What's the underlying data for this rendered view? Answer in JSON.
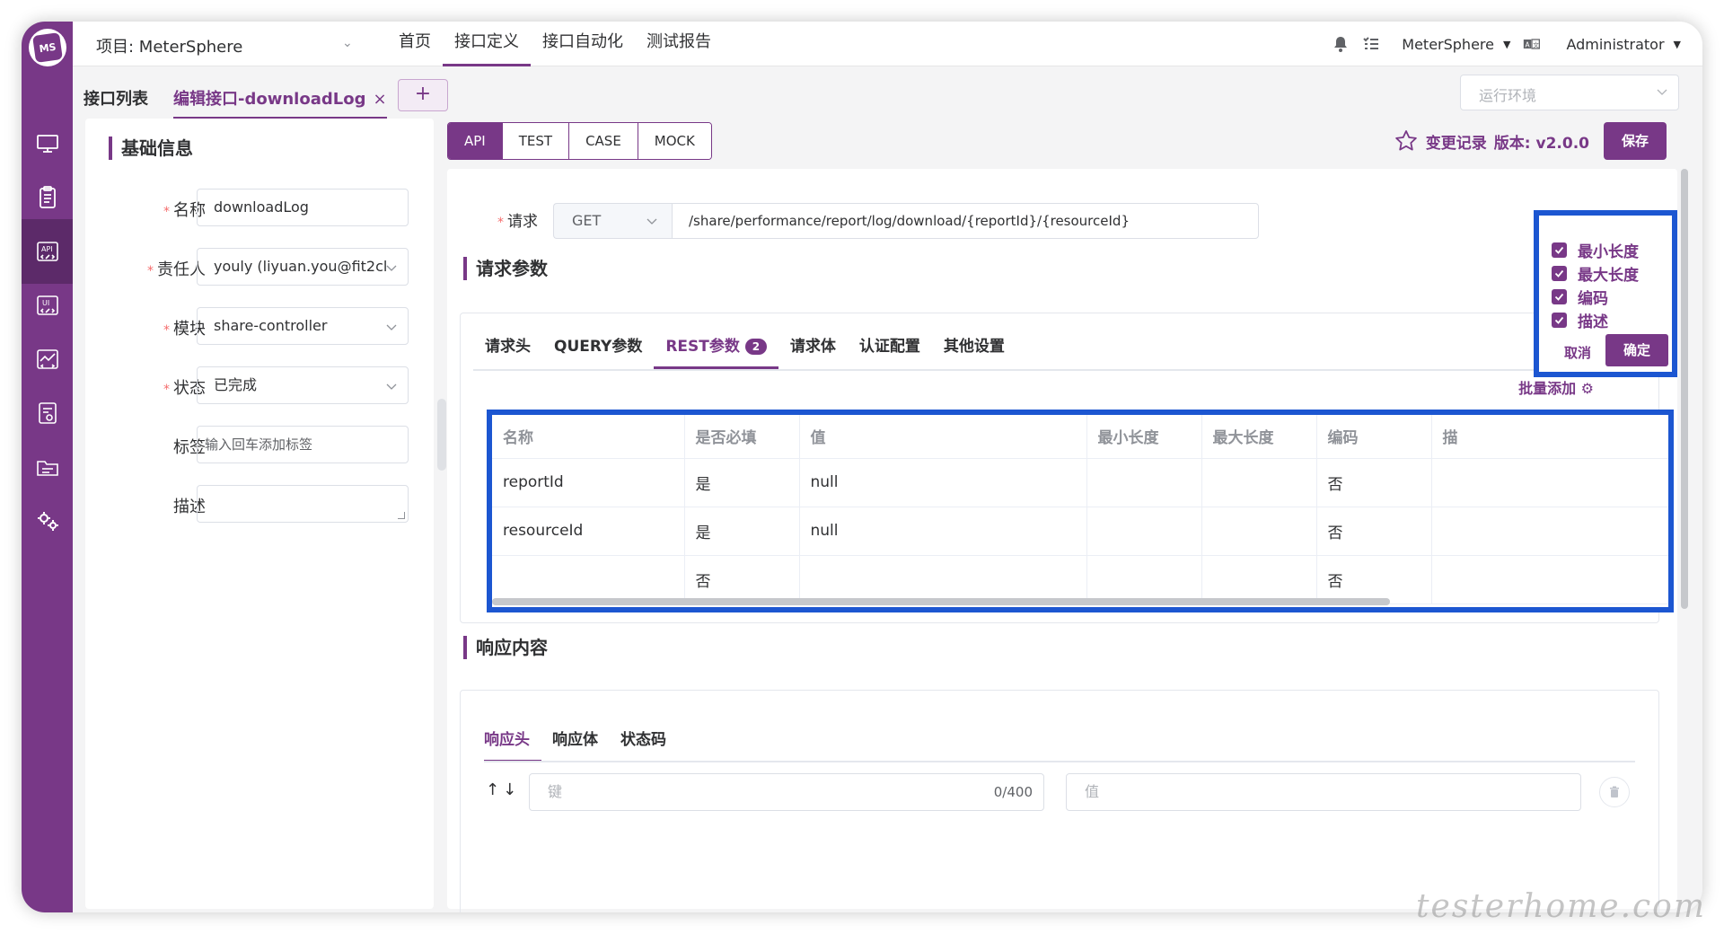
{
  "header": {
    "project_label": "项目: MeterSphere",
    "menu": [
      "首页",
      "接口定义",
      "接口自动化",
      "测试报告"
    ],
    "active_menu": 1,
    "workspace": "MeterSphere",
    "user": "Administrator"
  },
  "sidebar": {
    "logo_text": "MS",
    "items": [
      "workstation-icon",
      "test-track-icon",
      "api-icon",
      "ui-icon",
      "performance-icon",
      "report-icon",
      "project-icon",
      "settings-icon"
    ],
    "active_index": 2
  },
  "tabs": {
    "list_label": "接口列表",
    "edit_label": "编辑接口-downloadLog",
    "close_glyph": "×",
    "add_glyph": "+",
    "env_placeholder": "运行环境"
  },
  "basic_info": {
    "title": "基础信息",
    "fields": [
      {
        "label": "名称",
        "value": "downloadLog",
        "required": "*"
      },
      {
        "label": "责任人",
        "value": "youly (liyuan.you@fit2cl",
        "required": "*"
      },
      {
        "label": "模块",
        "value": "share-controller",
        "required": "*"
      },
      {
        "label": "状态",
        "value": "已完成",
        "required": "*"
      },
      {
        "label": "标签",
        "placeholder": "输入回车添加标签"
      },
      {
        "label": "描述",
        "value": ""
      }
    ]
  },
  "mode_buttons": [
    "API",
    "TEST",
    "CASE",
    "MOCK"
  ],
  "active_mode": 0,
  "version_bar": {
    "change_log": "变更记录",
    "version": "版本: v2.0.0",
    "save": "保存"
  },
  "request": {
    "label": "请求",
    "required": "*",
    "method": "GET",
    "url": "/share/performance/report/log/download/{reportId}/{resourceId}"
  },
  "request_params": {
    "title": "请求参数",
    "tabs": [
      "请求头",
      "QUERY参数",
      "REST参数",
      "请求体",
      "认证配置",
      "其他设置"
    ],
    "active_tab": 2,
    "rest_badge": "2",
    "batch_add": "批量添加",
    "columns": [
      "名称",
      "是否必填",
      "值",
      "最小长度",
      "最大长度",
      "编码",
      "描"
    ],
    "rows": [
      [
        "reportId",
        "是",
        "null",
        "",
        "",
        "否",
        ""
      ],
      [
        "resourceId",
        "是",
        "null",
        "",
        "",
        "否",
        ""
      ],
      [
        "",
        "否",
        "",
        "",
        "",
        "否",
        ""
      ]
    ]
  },
  "column_popover": {
    "options": [
      "最小长度",
      "最大长度",
      "编码",
      "描述"
    ],
    "cancel": "取消",
    "confirm": "确定"
  },
  "response": {
    "title": "响应内容",
    "tabs": [
      "响应头",
      "响应体",
      "状态码"
    ],
    "active_tab": 0,
    "sort_glyph": "↑↓",
    "key_placeholder": "键",
    "key_count": "0/400",
    "value_placeholder": "值"
  },
  "watermark": "testerhome.com",
  "colors": {
    "brand": "#783887",
    "highlight": "#1c56d1"
  }
}
